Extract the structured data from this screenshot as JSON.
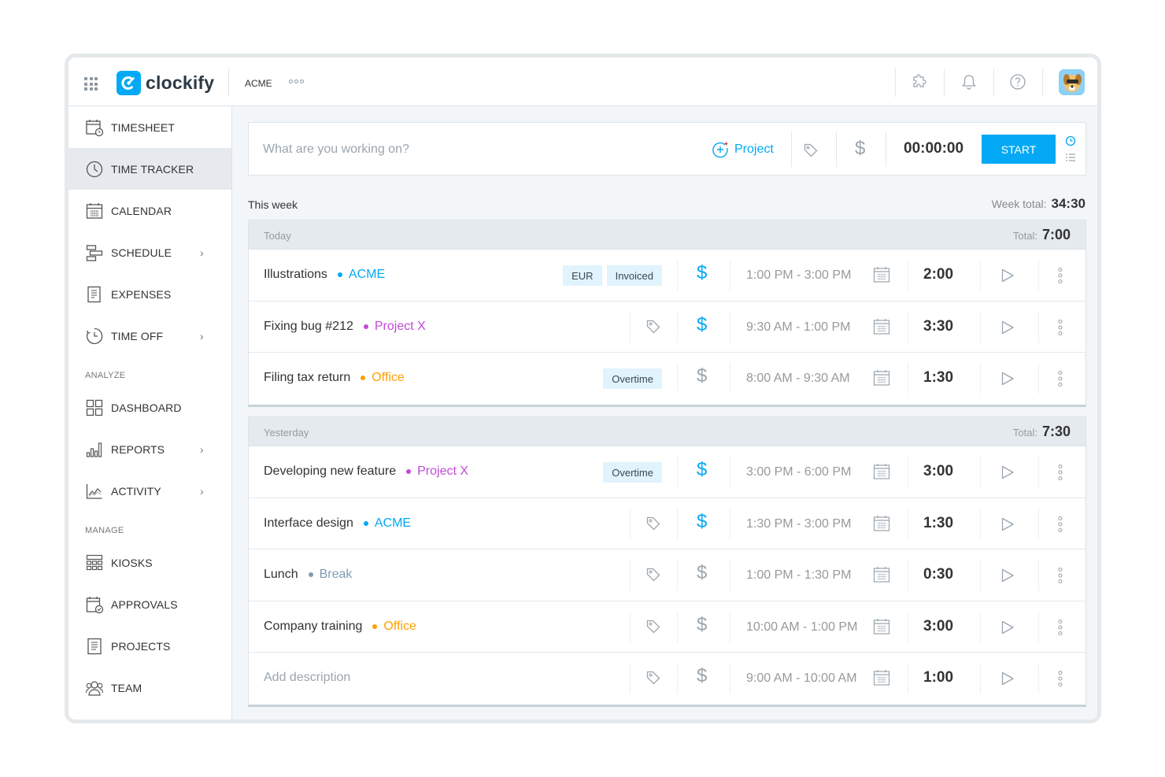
{
  "brand": {
    "name": "clockify",
    "accent": "#03a9f4"
  },
  "header": {
    "workspace": "ACME",
    "icons": [
      "apps-grid-icon",
      "puzzle-icon",
      "bell-icon",
      "help-icon",
      "avatar"
    ]
  },
  "sidebar": {
    "items": [
      {
        "id": "timesheet",
        "label": "TIMESHEET",
        "icon": "timesheet-icon",
        "chevron": false
      },
      {
        "id": "time-tracker",
        "label": "TIME TRACKER",
        "icon": "clock-icon",
        "chevron": false,
        "active": true
      },
      {
        "id": "calendar",
        "label": "CALENDAR",
        "icon": "calendar-icon",
        "chevron": false
      },
      {
        "id": "schedule",
        "label": "SCHEDULE",
        "icon": "schedule-icon",
        "chevron": true
      },
      {
        "id": "expenses",
        "label": "EXPENSES",
        "icon": "receipt-icon",
        "chevron": false
      },
      {
        "id": "time-off",
        "label": "TIME OFF",
        "icon": "time-off-icon",
        "chevron": true
      }
    ],
    "analyze_title": "ANALYZE",
    "analyze_items": [
      {
        "id": "dashboard",
        "label": "DASHBOARD",
        "icon": "dashboard-icon",
        "chevron": false
      },
      {
        "id": "reports",
        "label": "REPORTS",
        "icon": "bar-chart-icon",
        "chevron": true
      },
      {
        "id": "activity",
        "label": "ACTIVITY",
        "icon": "activity-icon",
        "chevron": true
      }
    ],
    "manage_title": "MANAGE",
    "manage_items": [
      {
        "id": "kiosks",
        "label": "KIOSKS",
        "icon": "kiosk-icon",
        "chevron": false
      },
      {
        "id": "approvals",
        "label": "APPROVALS",
        "icon": "approvals-icon",
        "chevron": false
      },
      {
        "id": "projects",
        "label": "PROJECTS",
        "icon": "document-icon",
        "chevron": false
      },
      {
        "id": "team",
        "label": "TEAM",
        "icon": "team-icon",
        "chevron": false
      }
    ]
  },
  "tracker": {
    "placeholder": "What are you working on?",
    "project_label": "Project",
    "time": "00:00:00",
    "start_label": "START"
  },
  "week": {
    "label": "This week",
    "total_label": "Week total:",
    "total": "34:30"
  },
  "groups": [
    {
      "title": "Today",
      "total_label": "Total:",
      "total": "7:00",
      "entries": [
        {
          "description": "Illustrations",
          "project": "ACME",
          "project_color": "#03a9f4",
          "badges": [
            "EUR",
            "Invoiced"
          ],
          "billable": true,
          "range": "1:00 PM - 3:00 PM",
          "duration": "2:00"
        },
        {
          "description": "Fixing bug #212",
          "project": "Project X",
          "project_color": "#c24ad6",
          "badges": [],
          "billable": true,
          "range": "9:30 AM - 1:00 PM",
          "duration": "3:30"
        },
        {
          "description": "Filing tax return",
          "project": "Office",
          "project_color": "#ffa000",
          "badges": [
            "Overtime"
          ],
          "billable": false,
          "range": "8:00 AM - 9:30 AM",
          "duration": "1:30"
        }
      ]
    },
    {
      "title": "Yesterday",
      "total_label": "Total:",
      "total": "7:30",
      "entries": [
        {
          "description": "Developing new feature",
          "project": "Project X",
          "project_color": "#c24ad6",
          "badges": [
            "Overtime"
          ],
          "billable": true,
          "range": "3:00 PM - 6:00 PM",
          "duration": "3:00"
        },
        {
          "description": "Interface design",
          "project": "ACME",
          "project_color": "#03a9f4",
          "badges": [],
          "billable": true,
          "range": "1:30 PM - 3:00 PM",
          "duration": "1:30"
        },
        {
          "description": "Lunch",
          "project": "Break",
          "project_color": "#7f9bb2",
          "badges": [],
          "billable": false,
          "range": "1:00 PM - 1:30 PM",
          "duration": "0:30"
        },
        {
          "description": "Company training",
          "project": "Office",
          "project_color": "#ffa000",
          "badges": [],
          "billable": false,
          "range": "10:00 AM - 1:00 PM",
          "duration": "3:00"
        },
        {
          "description": "",
          "placeholder": "Add description",
          "project": "",
          "project_color": "",
          "badges": [],
          "billable": false,
          "range": "9:00 AM - 10:00 AM",
          "duration": "1:00"
        }
      ]
    }
  ]
}
